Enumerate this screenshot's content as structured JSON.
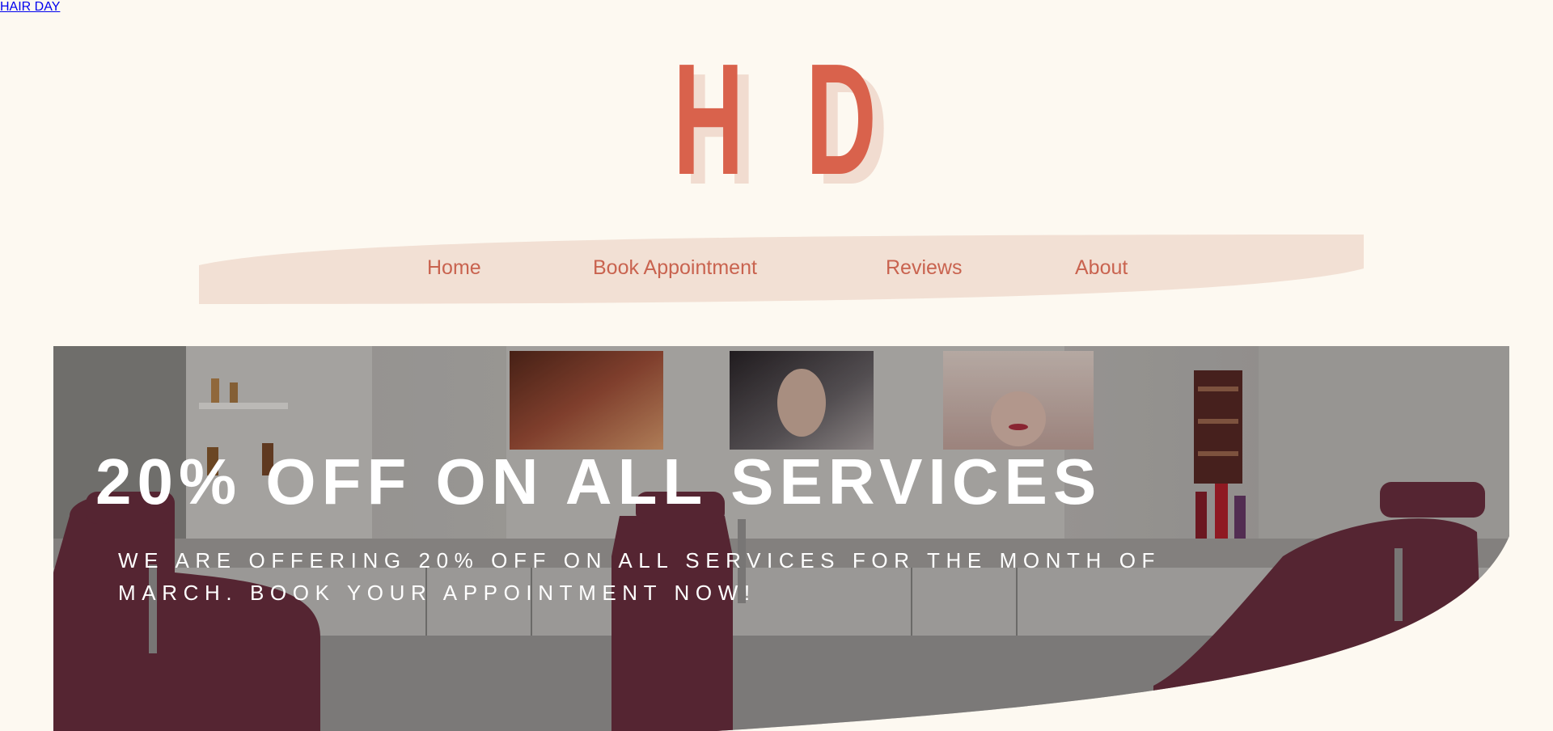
{
  "logo": {
    "letter_left": "H",
    "letter_right": "D",
    "tagline": "HAIR DAY"
  },
  "nav": {
    "items": [
      {
        "label": "Home"
      },
      {
        "label": "Book Appointment"
      },
      {
        "label": "Reviews"
      },
      {
        "label": "About"
      }
    ]
  },
  "hero": {
    "title": "20% OFF ON ALL SERVICES",
    "subtitle": "WE ARE OFFERING 20% OFF ON ALL SERVICES FOR THE MONTH OF MARCH. BOOK YOUR APPOINTMENT NOW!"
  },
  "colors": {
    "background": "#fdf9f1",
    "brand": "#d9624c",
    "brand_light": "#f2e0d4",
    "nav_text": "#c9634f"
  }
}
